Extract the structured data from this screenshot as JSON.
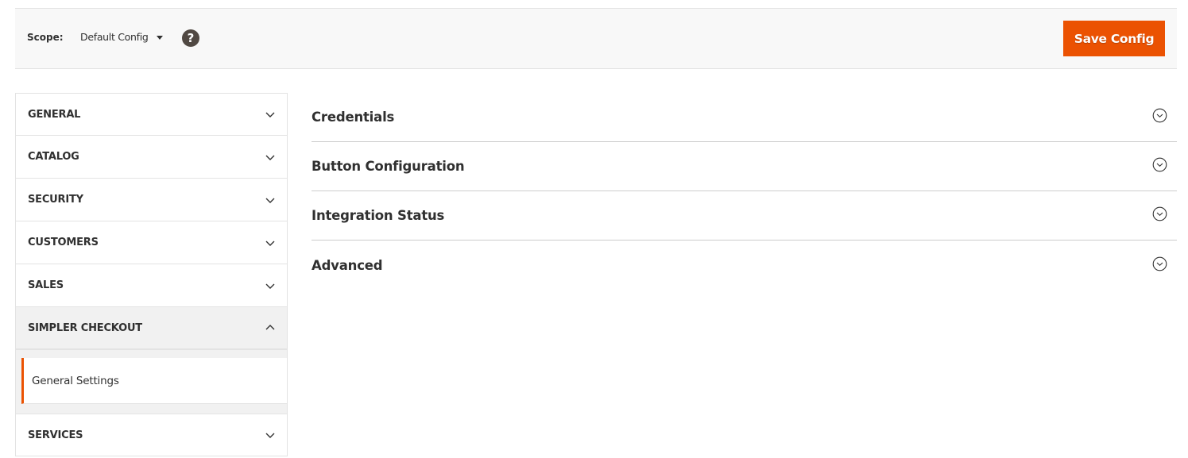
{
  "scope_bar": {
    "label": "Scope:",
    "selected_scope": "Default Config",
    "help_icon": "?",
    "save_button": "Save Config"
  },
  "sidebar": {
    "items": [
      {
        "label": "GENERAL",
        "expanded": false
      },
      {
        "label": "CATALOG",
        "expanded": false
      },
      {
        "label": "SECURITY",
        "expanded": false
      },
      {
        "label": "CUSTOMERS",
        "expanded": false
      },
      {
        "label": "SALES",
        "expanded": false
      },
      {
        "label": "SIMPLER CHECKOUT",
        "expanded": true,
        "children": [
          {
            "label": "General Settings",
            "active": true
          }
        ]
      },
      {
        "label": "SERVICES",
        "expanded": false
      }
    ]
  },
  "sections": [
    {
      "title": "Credentials"
    },
    {
      "title": "Button Configuration"
    },
    {
      "title": "Integration Status"
    },
    {
      "title": "Advanced"
    }
  ],
  "colors": {
    "accent": "#eb5202",
    "text": "#303030",
    "help_bg": "#514943"
  }
}
